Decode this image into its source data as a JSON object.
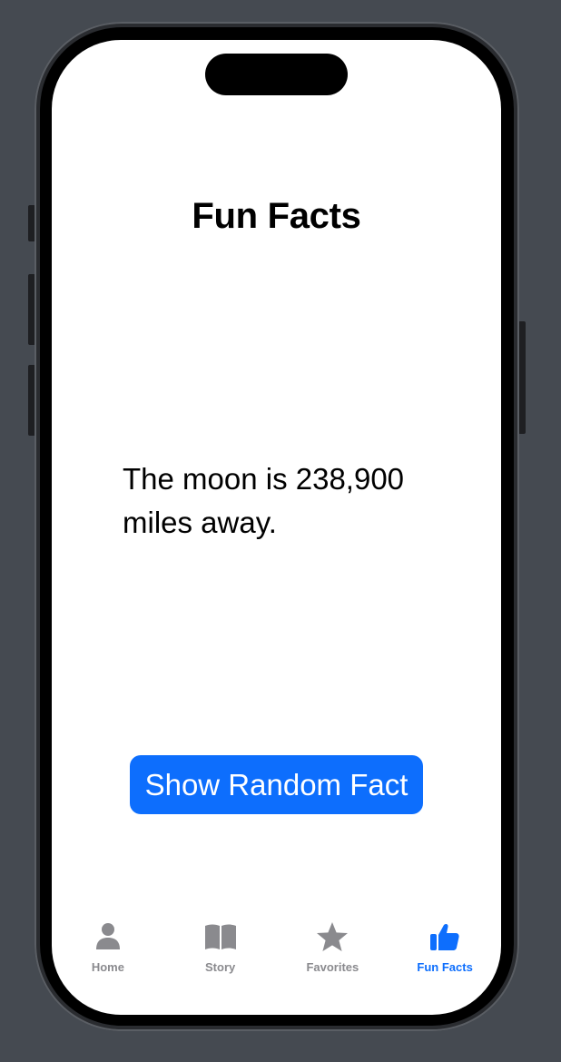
{
  "screen": {
    "title": "Fun Facts",
    "fact_text": "The moon is 238,900 miles away.",
    "button_label": "Show Random Fact"
  },
  "tabbar": {
    "items": [
      {
        "label": "Home",
        "icon": "person-icon",
        "active": false
      },
      {
        "label": "Story",
        "icon": "book-icon",
        "active": false
      },
      {
        "label": "Favorites",
        "icon": "star-icon",
        "active": false
      },
      {
        "label": "Fun Facts",
        "icon": "thumbs-up-icon",
        "active": true
      }
    ]
  },
  "colors": {
    "accent": "#0d6efd",
    "inactive_tab": "#8a8a8e",
    "background": "#454a51"
  }
}
